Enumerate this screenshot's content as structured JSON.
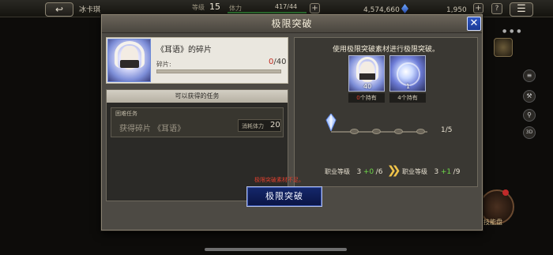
{
  "topbar": {
    "back_icon": "↩",
    "player_name": "冰卡琪",
    "level_label": "等级",
    "level_value": "15",
    "stamina_label": "体力",
    "stamina_value": "417/44",
    "gold_value": "4,574,660",
    "crystal_value": "1,950",
    "add_glyph": "+",
    "help_glyph": "?",
    "menu_icon": "☰"
  },
  "side": {
    "item_label": "技能盘"
  },
  "dialog": {
    "title": "极限突破",
    "close_glyph": "✕",
    "item": {
      "name": "《耳语》的碎片",
      "fragment_label": "碎片:",
      "fragment_have": "0",
      "fragment_need": "/40"
    },
    "missions": {
      "header": "可以获得的任务",
      "entries": [
        {
          "difficulty": "困难任务",
          "name": "获得碎片 《耳语》",
          "cost_label": "消耗体力",
          "cost_value": "20"
        }
      ]
    },
    "breakthrough": {
      "instruction": "使用极限突破素材进行极限突破。",
      "materials": [
        {
          "qty": "40",
          "owned": "0",
          "owned_suffix": "个持有",
          "icon": "portrait-fragment-icon"
        },
        {
          "qty": "1",
          "owned": "4",
          "owned_suffix": "个持有",
          "icon": "crystal-orb-icon"
        }
      ],
      "progress": "1/5",
      "from_label": "职业等级",
      "from_base": "3",
      "from_plus": "+0",
      "from_max": "/6",
      "to_label": "职业等级",
      "to_base": "3",
      "to_plus": "+1",
      "to_max": "/9",
      "arrow_glyph": "❯❯"
    },
    "warning": "极限突破素材不足。",
    "button_label": "极限突破"
  },
  "colors": {
    "accent_blue": "#1b3a93",
    "warning_red": "#e0402f",
    "plus_green": "#6fd94a",
    "arrow_gold": "#f1c44a"
  }
}
